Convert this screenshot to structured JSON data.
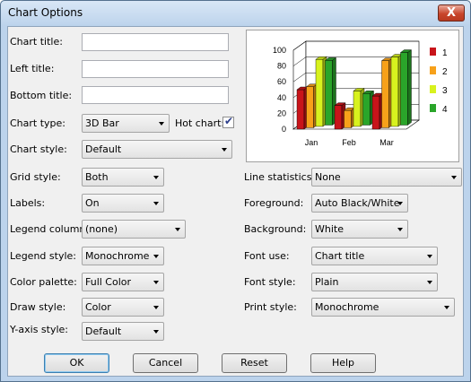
{
  "window": {
    "title": "Chart Options",
    "close_glyph": "X"
  },
  "labels": {
    "chart_title": "Chart title:",
    "left_title": "Left title:",
    "bottom_title": "Bottom title:",
    "chart_type": "Chart type:",
    "hot_chart": "Hot chart:",
    "chart_style": "Chart style:",
    "grid_style": "Grid style:",
    "labels": "Labels:",
    "legend_column": "Legend column:",
    "legend_style": "Legend style:",
    "color_palette": "Color palette:",
    "draw_style": "Draw style:",
    "y_axis_style": "Y-axis style:",
    "line_statistics": "Line statistics:",
    "foreground": "Foreground:",
    "background": "Background:",
    "font_use": "Font use:",
    "font_style": "Font style:",
    "print_style": "Print style:"
  },
  "values": {
    "chart_title": "",
    "left_title": "",
    "bottom_title": "",
    "chart_type": "3D Bar",
    "hot_chart_checked": true,
    "chart_style": "Default",
    "grid_style": "Both",
    "labels": "On",
    "legend_column": "(none)",
    "legend_style": "Monochrome",
    "color_palette": "Full Color",
    "draw_style": "Color",
    "y_axis_style": "Default",
    "line_statistics": "None",
    "foreground": "Auto Black/White",
    "background": "White",
    "font_use": "Chart title",
    "font_style": "Plain",
    "print_style": "Monochrome"
  },
  "buttons": {
    "ok": "OK",
    "cancel": "Cancel",
    "reset": "Reset",
    "help": "Help"
  },
  "colors": {
    "series1": "#c8141a",
    "series2": "#f7a11a",
    "series3": "#d8f21e",
    "series4": "#2aa52a"
  },
  "chart_data": {
    "type": "bar",
    "categories": [
      "Jan",
      "Feb",
      "Mar"
    ],
    "series": [
      {
        "name": "1",
        "values": [
          50,
          30,
          42
        ]
      },
      {
        "name": "2",
        "values": [
          52,
          22,
          85
        ]
      },
      {
        "name": "3",
        "values": [
          85,
          45,
          88
        ]
      },
      {
        "name": "4",
        "values": [
          82,
          40,
          92
        ]
      }
    ],
    "y_ticks": [
      "100",
      "80",
      "60",
      "40",
      "20",
      "0"
    ],
    "ylim": [
      0,
      100
    ],
    "grid": true,
    "legend": "right"
  }
}
